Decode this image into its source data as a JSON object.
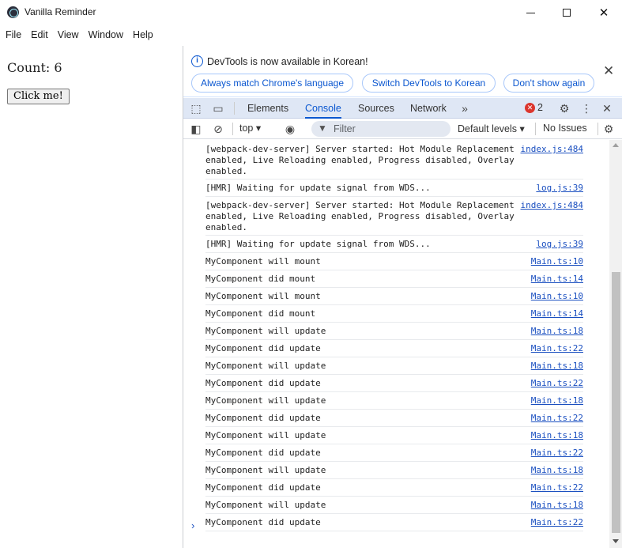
{
  "window": {
    "title": "Vanilla Reminder"
  },
  "menu": [
    "File",
    "Edit",
    "View",
    "Window",
    "Help"
  ],
  "app": {
    "count_label": "Count: 6",
    "click_button": "Click me!"
  },
  "devtools": {
    "infobar": {
      "message": "DevTools is now available in Korean!",
      "buttons": [
        "Always match Chrome's language",
        "Switch DevTools to Korean",
        "Don't show again"
      ]
    },
    "tabs": [
      "Elements",
      "Console",
      "Sources",
      "Network"
    ],
    "active_tab": "Console",
    "error_count": "2",
    "toolbar": {
      "context": "top",
      "filter_placeholder": "Filter",
      "levels": "Default levels",
      "issues": "No Issues"
    },
    "logs": [
      {
        "msg": "[webpack-dev-server] Server started: Hot Module Replacement enabled, Live Reloading enabled, Progress disabled, Overlay enabled.",
        "src": "index.js:484"
      },
      {
        "msg": "[HMR] Waiting for update signal from WDS...",
        "src": "log.js:39"
      },
      {
        "msg": "[webpack-dev-server] Server started: Hot Module Replacement enabled, Live Reloading enabled, Progress disabled, Overlay enabled.",
        "src": "index.js:484"
      },
      {
        "msg": "[HMR] Waiting for update signal from WDS...",
        "src": "log.js:39"
      },
      {
        "msg": "MyComponent will mount",
        "src": "Main.ts:10"
      },
      {
        "msg": "MyComponent did mount",
        "src": "Main.ts:14"
      },
      {
        "msg": "MyComponent will mount",
        "src": "Main.ts:10"
      },
      {
        "msg": "MyComponent did mount",
        "src": "Main.ts:14"
      },
      {
        "msg": "MyComponent will update",
        "src": "Main.ts:18"
      },
      {
        "msg": "MyComponent did update",
        "src": "Main.ts:22"
      },
      {
        "msg": "MyComponent will update",
        "src": "Main.ts:18"
      },
      {
        "msg": "MyComponent did update",
        "src": "Main.ts:22"
      },
      {
        "msg": "MyComponent will update",
        "src": "Main.ts:18"
      },
      {
        "msg": "MyComponent did update",
        "src": "Main.ts:22"
      },
      {
        "msg": "MyComponent will update",
        "src": "Main.ts:18"
      },
      {
        "msg": "MyComponent did update",
        "src": "Main.ts:22"
      },
      {
        "msg": "MyComponent will update",
        "src": "Main.ts:18"
      },
      {
        "msg": "MyComponent did update",
        "src": "Main.ts:22"
      },
      {
        "msg": "MyComponent will update",
        "src": "Main.ts:18"
      },
      {
        "msg": "MyComponent did update",
        "src": "Main.ts:22"
      }
    ],
    "prompt_symbol": "›"
  }
}
